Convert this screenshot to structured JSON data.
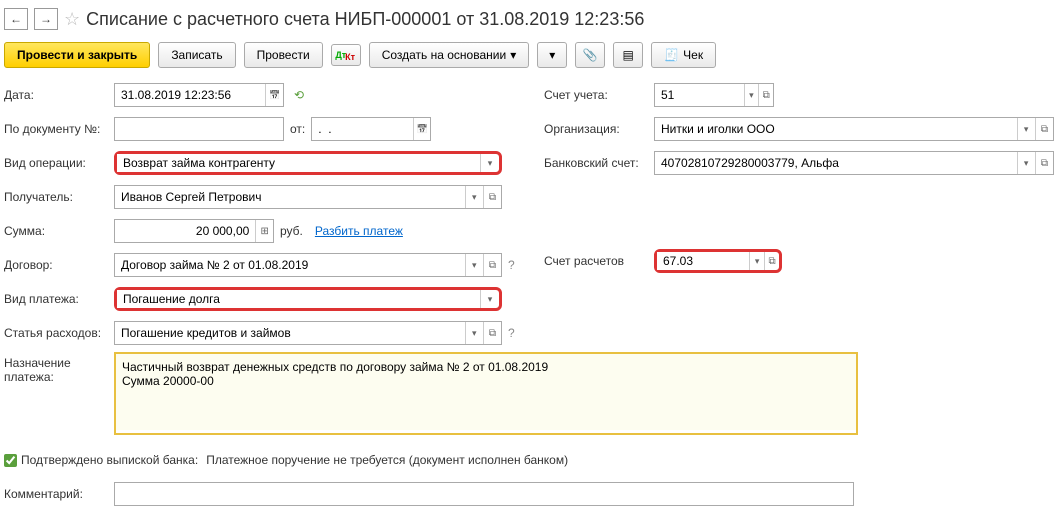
{
  "title": "Списание с расчетного счета НИБП-000001 от 31.08.2019 12:23:56",
  "toolbar": {
    "postClose": "Провести и закрыть",
    "save": "Записать",
    "post": "Провести",
    "createFrom": "Создать на основании",
    "check": "Чек"
  },
  "labels": {
    "date": "Дата:",
    "docNum": "По документу №:",
    "docFrom": "от:",
    "opType": "Вид операции:",
    "recipient": "Получатель:",
    "amount": "Сумма:",
    "contract": "Договор:",
    "payType": "Вид платежа:",
    "expItem": "Статья расходов:",
    "purpose": "Назначение платежа:",
    "account": "Счет учета:",
    "org": "Организация:",
    "bankAcc": "Банковский счет:",
    "settleAcc": "Счет расчетов",
    "confirmed": "Подтверждено выпиской банка:",
    "confirmedNote": "Платежное поручение не требуется (документ исполнен банком)",
    "comment": "Комментарий:",
    "currency": "руб.",
    "split": "Разбить платеж"
  },
  "values": {
    "date": "31.08.2019 12:23:56",
    "docNum": "",
    "docFrom": ".  .",
    "opType": "Возврат займа контрагенту",
    "recipient": "Иванов Сергей Петрович",
    "amount": "20 000,00",
    "contract": "Договор займа № 2 от 01.08.2019",
    "payType": "Погашение долга",
    "expItem": "Погашение кредитов и займов",
    "purpose": "Частичный возврат денежных средств по договору займа № 2 от 01.08.2019\nСумма 20000-00",
    "account": "51",
    "org": "Нитки и иголки ООО",
    "bankAcc": "40702810729280003779, Альфа",
    "settleAcc": "67.03",
    "comment": ""
  }
}
